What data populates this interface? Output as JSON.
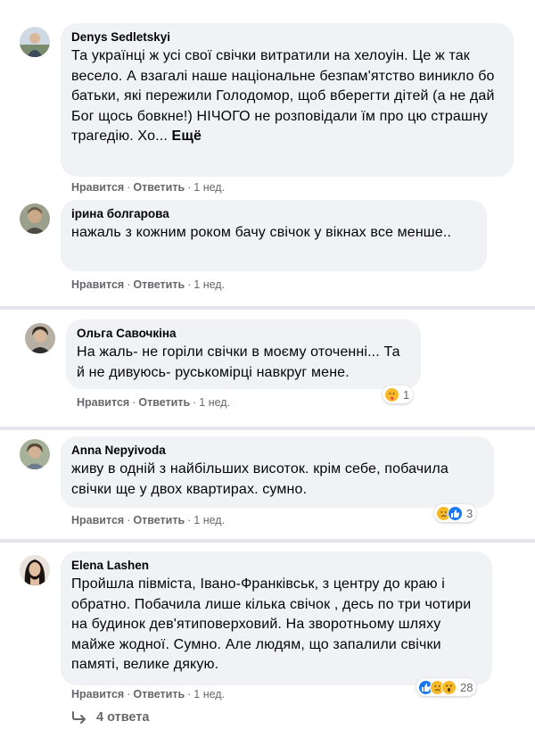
{
  "comments": [
    {
      "author": "Denys Sedletskyi",
      "text": "Та українці ж усі свої свічки витратили на хелоуін. Це ж так весело. А взагалі наше національне безпам'ятство виникло бо батьки, які пережили Голодомор, щоб вберегти дітей (а не дай Бог щось бовкне!) НІЧОГО не розповідали їм про цю страшну трагедію. Хо...",
      "more": "Ещё",
      "like": "Нравится",
      "reply": "Ответить",
      "time": "1 нед."
    },
    {
      "author": "ірина болгарова",
      "text": "нажаль з кожним роком бачу свічок у вікнах все менше..",
      "like": "Нравится",
      "reply": "Ответить",
      "time": "1 нед."
    },
    {
      "author": "Ольга Савочкіна",
      "text": "На жаль- не горіли свічки в моєму оточенні... Та й не дивуюсь- руськомірці навкруг мене.",
      "like": "Нравится",
      "reply": "Ответить",
      "time": "1 нед.",
      "reactions": {
        "icons": [
          "care-icon"
        ],
        "count": "1"
      }
    },
    {
      "author": "Anna Nepyivoda",
      "text": "живу в одній з найбільших висоток. крім себе, побачила свічки ще у двох квартирах. сумно.",
      "like": "Нравится",
      "reply": "Ответить",
      "time": "1 нед.",
      "reactions": {
        "icons": [
          "sad-icon",
          "like-icon"
        ],
        "count": "3"
      }
    },
    {
      "author": "Elena Lashen",
      "text": "Пройшла півміста, Івано-Франківськ, з центру до краю і обратно. Побачила лише кілька свічок , десь по три чотири на будинок дев'ятиповерховий. На зворотньому шляху майже жодної. Сумно. Але людям, що запалили свічки памяті, велике дякую.",
      "like": "Нравится",
      "reply": "Ответить",
      "time": "1 нед.",
      "reactions": {
        "icons": [
          "like-icon",
          "sad-icon",
          "wow-icon"
        ],
        "count": "28"
      }
    }
  ],
  "replies_label": "4 ответа",
  "colors": {
    "bubble": "#f0f2f5",
    "meta": "#65676b",
    "like_blue": "#1877f2",
    "sad_yellow": "#f7b928"
  }
}
